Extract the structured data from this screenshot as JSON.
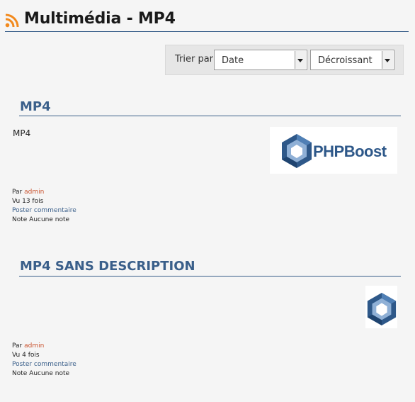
{
  "header": {
    "title": "Multimédia - MP4",
    "icon": "rss-icon"
  },
  "sort": {
    "label": "Trier par",
    "field": {
      "value": "Date"
    },
    "order": {
      "value": "Décroissant"
    }
  },
  "items": [
    {
      "title": "MP4",
      "description": "MP4",
      "author_prefix": "Par ",
      "author": "admin",
      "views": "Vu 13 fois",
      "comment_link": "Poster commentaire",
      "rating": "Note Aucune note",
      "thumbnail": {
        "logo_text": "PHPBoost",
        "icon": "phpboost-logo-icon"
      }
    },
    {
      "title": "MP4 SANS DESCRIPTION",
      "author_prefix": "Par ",
      "author": "admin",
      "views": "Vu 4 fois",
      "comment_link": "Poster commentaire",
      "rating": "Note Aucune note",
      "thumbnail": {
        "icon": "phpboost-logo-icon"
      }
    }
  ],
  "colors": {
    "accent": "#3a5f8a",
    "author": "#c9532f",
    "rss": "#f28a1e"
  }
}
